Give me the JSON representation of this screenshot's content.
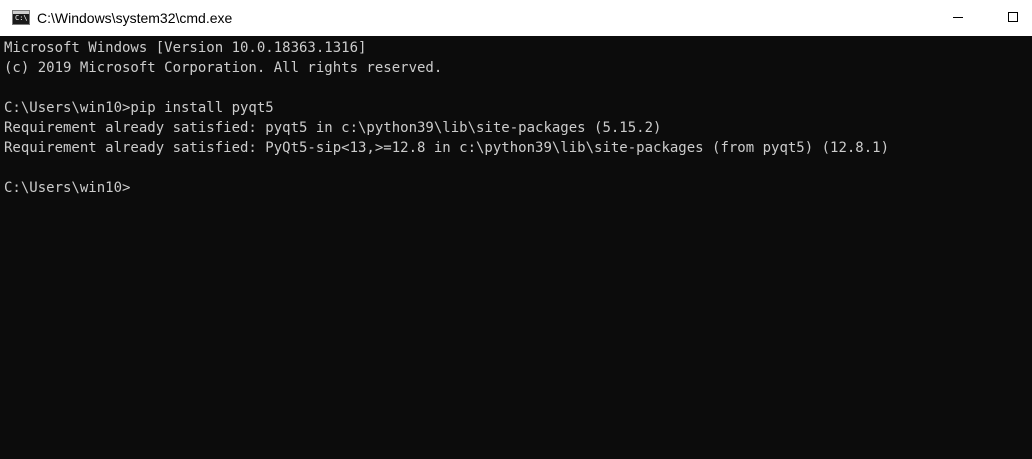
{
  "window": {
    "title": "C:\\Windows\\system32\\cmd.exe",
    "app_icon_glyph": "C:\\",
    "icons": {
      "app": "command-prompt-icon",
      "minimize": "minimize-icon",
      "maximize": "maximize-icon"
    }
  },
  "console": {
    "background": "#0c0c0c",
    "foreground": "#cccccc",
    "lines": [
      "Microsoft Windows [Version 10.0.18363.1316]",
      "(c) 2019 Microsoft Corporation. All rights reserved.",
      "",
      "C:\\Users\\win10>pip install pyqt5",
      "Requirement already satisfied: pyqt5 in c:\\python39\\lib\\site-packages (5.15.2)",
      "Requirement already satisfied: PyQt5-sip<13,>=12.8 in c:\\python39\\lib\\site-packages (from pyqt5) (12.8.1)",
      "",
      "C:\\Users\\win10>"
    ]
  }
}
